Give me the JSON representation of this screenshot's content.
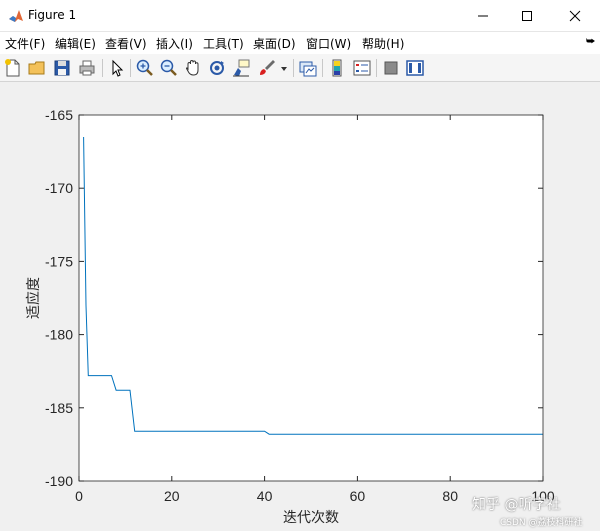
{
  "window": {
    "title": "Figure 1",
    "controls": [
      "minimize-icon",
      "maximize-icon",
      "close-icon"
    ]
  },
  "menu": {
    "items": [
      "文件(F)",
      "编辑(E)",
      "查看(V)",
      "插入(I)",
      "工具(T)",
      "桌面(D)",
      "窗口(W)",
      "帮助(H)"
    ],
    "overflow_icon": "double-chevron-icon"
  },
  "toolbar": {
    "icons": [
      "new-figure-icon",
      "open-file-icon",
      "save-icon",
      "print-icon",
      "pointer-icon",
      "zoom-in-icon",
      "zoom-out-icon",
      "pan-icon",
      "rotate-3d-icon",
      "data-cursor-icon",
      "brush-icon",
      "link-plot-icon",
      "insert-colorbar-icon",
      "insert-legend-icon",
      "hide-plot-tools-icon",
      "show-plot-tools-icon"
    ]
  },
  "chart_data": {
    "type": "line",
    "xlabel": "迭代次数",
    "ylabel": "适应度",
    "xlim": [
      0,
      100
    ],
    "ylim": [
      -190,
      -165
    ],
    "xticks": [
      0,
      20,
      40,
      60,
      80,
      100
    ],
    "yticks": [
      -165,
      -170,
      -175,
      -180,
      -185,
      -190
    ],
    "grid": false,
    "series": [
      {
        "color": "#0072bd",
        "x": [
          1,
          1.5,
          2,
          7,
          8,
          11,
          12,
          40,
          41,
          100
        ],
        "y": [
          -166.5,
          -178.0,
          -182.8,
          -182.8,
          -183.8,
          -183.8,
          -186.6,
          -186.6,
          -186.8,
          -186.8
        ]
      }
    ]
  },
  "watermark": {
    "line1": "知乎 @听字社",
    "line2": "CSDN @荔枝科研社"
  }
}
